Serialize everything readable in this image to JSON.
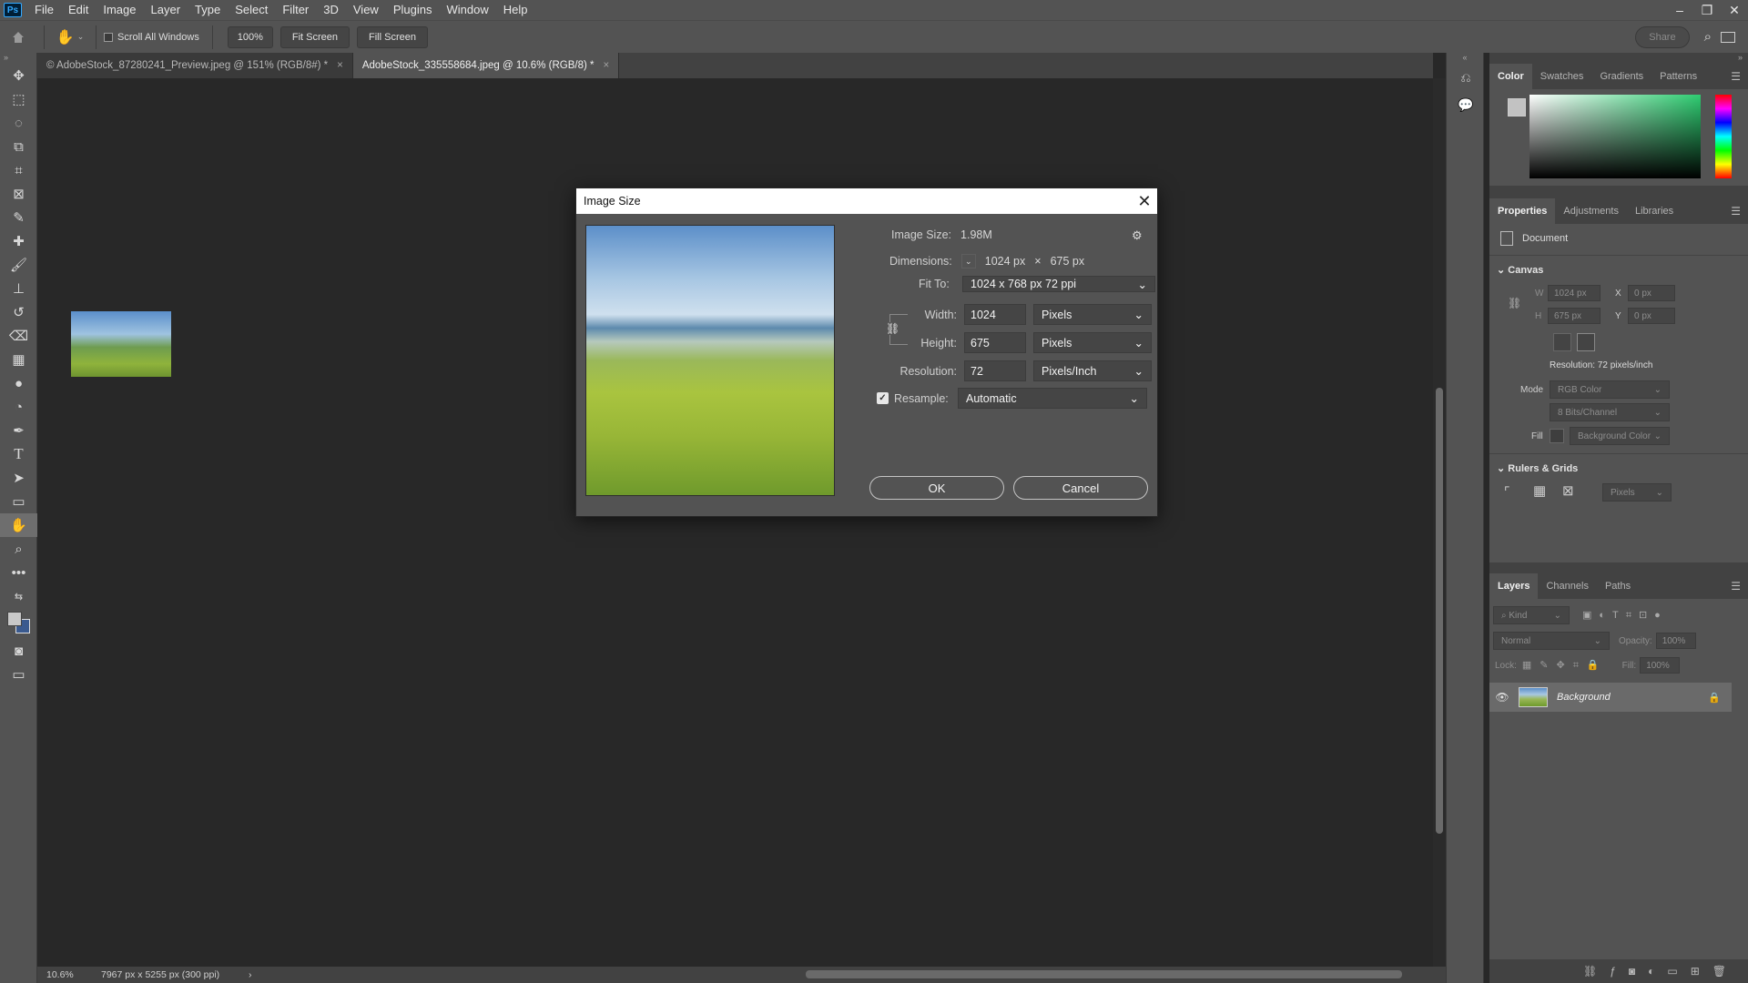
{
  "app": {
    "logo": "Ps"
  },
  "menu": [
    "File",
    "Edit",
    "Image",
    "Layer",
    "Type",
    "Select",
    "Filter",
    "3D",
    "View",
    "Plugins",
    "Window",
    "Help"
  ],
  "window_controls": {
    "minimize": "–",
    "restore": "❐",
    "close": "✕"
  },
  "options_bar": {
    "scroll_all_label": "Scroll All Windows",
    "zoom_btn": "100%",
    "fit_screen": "Fit Screen",
    "fill_screen": "Fill Screen",
    "share": "Share"
  },
  "tabs": [
    {
      "label": "© AdobeStock_87280241_Preview.jpeg @ 151% (RGB/8#) *",
      "close": "×"
    },
    {
      "label": "AdobeStock_335558684.jpeg @ 10.6% (RGB/8) *",
      "close": "×"
    }
  ],
  "status": {
    "zoom": "10.6%",
    "doc_info": "7967 px x 5255 px (300 ppi)",
    "arrow": "›"
  },
  "dialog": {
    "title": "Image Size",
    "close": "✕",
    "image_size_label": "Image Size:",
    "image_size_value": "1.98M",
    "dimensions_label": "Dimensions:",
    "dim_w": "1024 px",
    "dim_x": "×",
    "dim_h": "675 px",
    "fit_to_label": "Fit To:",
    "fit_to_value": "1024 x 768 px 72 ppi",
    "width_label": "Width:",
    "width_value": "1024",
    "width_unit": "Pixels",
    "height_label": "Height:",
    "height_value": "675",
    "height_unit": "Pixels",
    "resolution_label": "Resolution:",
    "resolution_value": "72",
    "resolution_unit": "Pixels/Inch",
    "resample_label": "Resample:",
    "resample_value": "Automatic",
    "ok": "OK",
    "cancel": "Cancel"
  },
  "color_panel": {
    "tabs": [
      "Color",
      "Swatches",
      "Gradients",
      "Patterns"
    ]
  },
  "properties_panel": {
    "tabs": [
      "Properties",
      "Adjustments",
      "Libraries"
    ],
    "doc_label": "Document",
    "canvas_title": "Canvas",
    "w_label": "W",
    "w_value": "1024 px",
    "h_label": "H",
    "h_value": "675 px",
    "x_label": "X",
    "x_value": "0 px",
    "y_label": "Y",
    "y_value": "0 px",
    "resolution_text": "Resolution: 72 pixels/inch",
    "mode_label": "Mode",
    "mode_value": "RGB Color",
    "bits_value": "8 Bits/Channel",
    "fill_label": "Fill",
    "fill_value": "Background Color",
    "rulers_title": "Rulers & Grids",
    "units_value": "Pixels"
  },
  "layers_panel": {
    "tabs": [
      "Layers",
      "Channels",
      "Paths"
    ],
    "kind_placeholder": "Kind",
    "blend_mode": "Normal",
    "opacity_label": "Opacity:",
    "opacity_value": "100%",
    "lock_label": "Lock:",
    "fill_label": "Fill:",
    "fill_value": "100%",
    "layer_name": "Background"
  }
}
